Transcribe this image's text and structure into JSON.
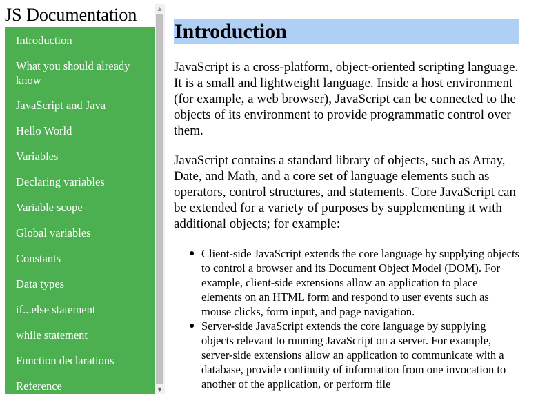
{
  "sidebar": {
    "title": "JS Documentation",
    "items": [
      {
        "label": "Introduction"
      },
      {
        "label": "What you should already know"
      },
      {
        "label": "JavaScript and Java"
      },
      {
        "label": "Hello World"
      },
      {
        "label": "Variables"
      },
      {
        "label": "Declaring variables"
      },
      {
        "label": "Variable scope"
      },
      {
        "label": "Global variables"
      },
      {
        "label": "Constants"
      },
      {
        "label": "Data types"
      },
      {
        "label": "if...else statement"
      },
      {
        "label": "while statement"
      },
      {
        "label": "Function declarations"
      },
      {
        "label": "Reference"
      }
    ],
    "colors": {
      "background": "#4caf50",
      "text": "#ffffff"
    }
  },
  "main": {
    "section_title": "Introduction",
    "paragraphs": [
      "JavaScript is a cross-platform, object-oriented scripting language. It is a small and lightweight language. Inside a host environment (for example, a web browser), JavaScript can be connected to the objects of its environment to provide programmatic control over them.",
      "JavaScript contains a standard library of objects, such as Array, Date, and Math, and a core set of language elements such as operators, control structures, and statements. Core JavaScript can be extended for a variety of purposes by supplementing it with additional objects; for example:"
    ],
    "bullets": [
      "Client-side JavaScript extends the core language by supplying objects to control a browser and its Document Object Model (DOM). For example, client-side extensions allow an application to place elements on an HTML form and respond to user events such as mouse clicks, form input, and page navigation.",
      "Server-side JavaScript extends the core language by supplying objects relevant to running JavaScript on a server. For example, server-side extensions allow an application to communicate with a database, provide continuity of information from one invocation to another of the application, or perform file"
    ],
    "colors": {
      "title_background": "#b0cff5"
    }
  },
  "icons": {
    "scroll_up": "scroll-up-arrow-icon",
    "scroll_down": "scroll-down-arrow-icon",
    "bullet": "bullet-dot-icon"
  }
}
